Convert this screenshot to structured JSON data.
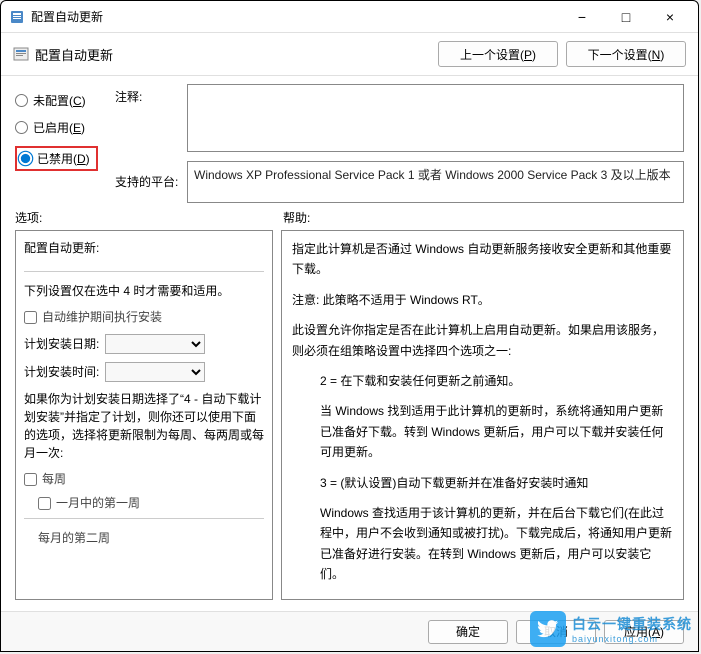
{
  "window": {
    "title": "配置自动更新",
    "minimize_label": "−",
    "maximize_label": "□",
    "close_label": "×"
  },
  "toolbar": {
    "title": "配置自动更新",
    "prev_button": "上一个设置(P)",
    "next_button": "下一个设置(N)"
  },
  "radios": {
    "not_configured": "未配置(C)",
    "enabled": "已启用(E)",
    "disabled": "已禁用(D)",
    "selected": "disabled"
  },
  "labels": {
    "comment": "注释:",
    "supported_on": "支持的平台:",
    "options": "选项:",
    "help": "帮助:"
  },
  "comment_value": "",
  "supported_platform": "Windows XP Professional Service Pack 1 或者 Windows 2000 Service Pack 3 及以上版本",
  "options": {
    "group_title": "配置自动更新:",
    "note": "下列设置仅在选中 4 时才需要和适用。",
    "auto_maint": "自动维护期间执行安装",
    "install_day_label": "计划安装日期:",
    "install_time_label": "计划安装时间:",
    "paragraph1": "如果你为计划安装日期选择了“4 - 自动下载计划安装”并指定了计划，则你还可以使用下面的选项，选择将更新限制为每周、每两周或每月一次:",
    "weekly": "每周",
    "first_week": "一月中的第一周",
    "more_row": "每月的第二周"
  },
  "help": {
    "p1": "指定此计算机是否通过 Windows 自动更新服务接收安全更新和其他重要下载。",
    "p2": "注意: 此策略不适用于 Windows RT。",
    "p3": "此设置允许你指定是否在此计算机上启用自动更新。如果启用该服务，则必须在组策略设置中选择四个选项之一:",
    "p4": "2 = 在下载和安装任何更新之前通知。",
    "p5": "当 Windows 找到适用于此计算机的更新时，系统将通知用户更新已准备好下载。转到 Windows 更新后，用户可以下载并安装任何可用更新。",
    "p6": "3 = (默认设置)自动下载更新并在准备好安装时通知",
    "p7": "Windows 查找适用于该计算机的更新，并在后台下载它们(在此过程中，用户不会收到通知或被打扰)。下载完成后，将通知用户更新已准备好进行安装。在转到 Windows 更新后，用户可以安装它们。"
  },
  "buttons": {
    "ok": "确定",
    "cancel": "取消",
    "apply": "应用(A)"
  },
  "watermark": {
    "line1": "白云一键重装系统",
    "line2": "baiyunxitong.com"
  }
}
